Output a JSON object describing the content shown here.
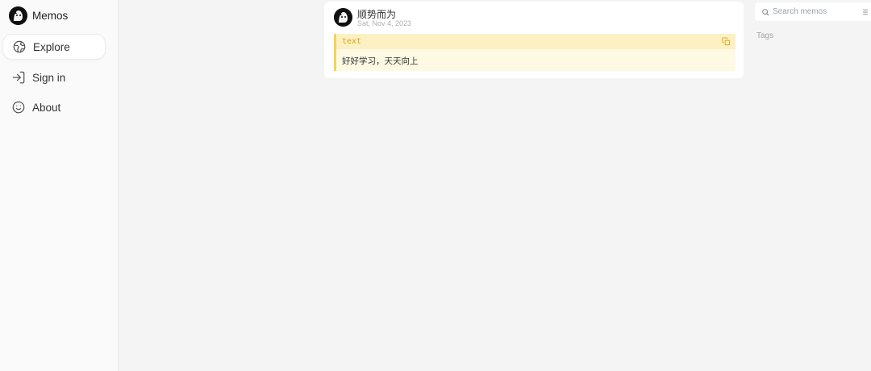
{
  "app": {
    "name": "Memos"
  },
  "sidebar": {
    "items": [
      {
        "label": "Explore",
        "icon": "globe-icon",
        "active": true
      },
      {
        "label": "Sign in",
        "icon": "sign-in-icon",
        "active": false
      },
      {
        "label": "About",
        "icon": "smile-icon",
        "active": false
      }
    ]
  },
  "memo": {
    "author": "顺势而为",
    "date": "Sat, Nov 4, 2023",
    "code_language": "text",
    "code_content": "好好学习，天天向上"
  },
  "right_panel": {
    "search_placeholder": "Search memos",
    "tags_label": "Tags"
  },
  "colors": {
    "code_accent": "#f4d35e",
    "code_bg": "#fef9e3",
    "code_lang": "#d9a514"
  }
}
